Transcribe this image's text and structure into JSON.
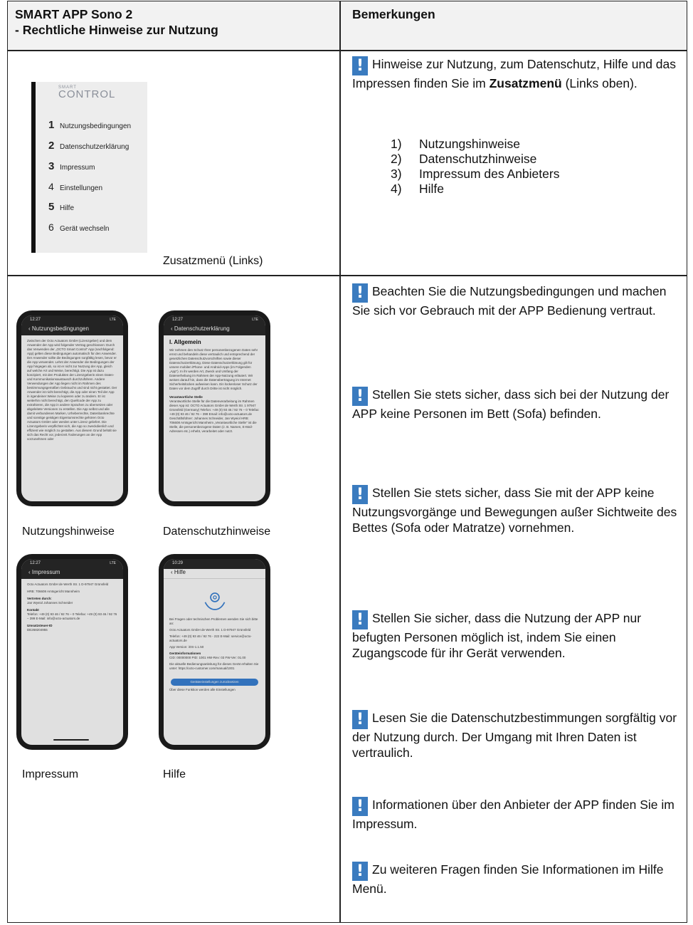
{
  "header": {
    "left_line1": "SMART APP Sono 2",
    "left_line2": "- Rechtliche Hinweise zur Nutzung",
    "right": "Bemerkungen"
  },
  "menu_screenshot": {
    "logo_small": "SMART",
    "logo_big": "CONTROL",
    "items": [
      {
        "num": "1",
        "label": "Nutzungsbedingungen"
      },
      {
        "num": "2",
        "label": "Datenschutzerklärung"
      },
      {
        "num": "3",
        "label": "Impressum"
      },
      {
        "num": "4",
        "label": "Einstellungen"
      },
      {
        "num": "5",
        "label": "Hilfe"
      },
      {
        "num": "6",
        "label": "Gerät wechseln"
      }
    ],
    "caption": "Zusatzmenü (Links)"
  },
  "section1_note": {
    "text_before": "Hinweise zur Nutzung, zum Datenschutz, Hilfe und das Impressen finden Sie im",
    "bold": "Zusatzmenü",
    "text_after": "(Links oben).",
    "list": [
      {
        "n": "1)",
        "t": "Nutzungshinweise"
      },
      {
        "n": "2)",
        "t": "Datenschutzhinweise"
      },
      {
        "n": "3)",
        "t": "Impressum des Anbieters"
      },
      {
        "n": "4)",
        "t": "Hilfe"
      }
    ]
  },
  "phones": {
    "p1": {
      "time": "12:27",
      "status": "LTE",
      "title": "Nutzungsbedingungen",
      "caption": "Nutzungshinweise",
      "text": "Zwischen der Octo Actuators GmbH (Lizenzgeber) und dem Anwender der App wird folgender Vertrag geschlossen: Durch das Verwenden der „OCTO Smart Control\" App (nachfolgend: App) gelten diese Bedingungen automatisch für den Anwender. Der Anwender sollte die Bedingungen sorgfältig lesen, bevor er die App verwendet. Lehnt der Anwender die Bedingungen der App hingegen ab, so ist er nicht zur Nutzung der App, gleich auf welche Art und Weise, berechtigt. Die App ist dazu konzipiert, mit den Produkten der Lizenzgeberin einen Daten- und Kommunikationsaustausch durchzuführen. Andere Verwendungen der App liegen nicht im Rahmen des bestimmungsgemäßen Gebrauchs und sind nicht gestattet. Der Anwender ist nicht berechtigt, die App oder einen Teil der App in irgendeiner Weise zu kopieren oder zu ändern. Er ist weiterhin nicht berechtigt, den Quellcode der App zu extrahieren, die App in andere Sprachen zu übersetzen oder abgeleitete Versionen zu erstellen. Die App selbst und alle damit verbundenen Marken, Urheberrechte, Datenbankrechte und sonstige geistigen Eigentumsrechte gehören Octo Actuators GmbH oder werden unter Lizenz geliefert. Die Lizenzgeberin verpflichtet sich, die App so zweckdienlich und effizient wie möglich zu gestalten. Aus diesem Grund behält sie sich das Recht vor, jederzeit Änderungen an der App vorzunehmen oder"
    },
    "p2": {
      "time": "12:27",
      "status": "LTE",
      "title": "Datenschutzerklärung",
      "caption": "Datenschutzhinweise",
      "heading": "I. Allgemein",
      "text1": "Wir nehmen den Schutz Ihrer personenbezogenen Daten sehr ernst und behandeln diese vertraulich und entsprechend der gesetzlichen Datenschutzvorschriften sowie dieser Datenschutzerklärung. Diese Datenschutzerklärung gilt für unsere mobilen iPhone- und Android-Apps (im Folgenden „App\"). In ihr werden Art, Zweck und Umfang der Datenerhebung im Rahmen der App-Nutzung erläutert. Wir weisen darauf hin, dass die Datenübertragung im Internet Sicherheitslücken aufweisen kann. Ein lückenloser Schutz der Daten vor dem Zugriff durch Dritte ist nicht möglich.",
      "sub": "Verantwortliche Stelle",
      "text2": "Verantwortliche Stelle für die Datenverarbeitung im Rahmen dieser App ist: OCTO Actuators GmbH de Werth Str. 1 97947 Grünsfeld (Germany) Telefon: +49 (0) 93 46 / 92 76 – 0 Telefax: +49 (0) 93 46 / 92 76 – 399 Email: info@octo-actuators.de Geschäftsführer: Johannes Schneider, Jan Wyeiol HRB: 706608 Amtsgericht Mannheim „Verantwortliche Stelle\" ist die Stelle, die personenbezogene Daten (z. B. Namen, E-Mail-Adressen etc.) erhebt, verarbeitet oder nutzt."
    },
    "p3": {
      "time": "12:27",
      "status": "LTE",
      "title": "Impressum",
      "caption": "Impressum",
      "text1": "Octo Actuators GmbH de Werth Str. 1 D-97947 Grünsfeld",
      "text2": "HRB: 706608 Amtsgericht Mannheim",
      "sub1": "Vertreten durch:",
      "text3": "Jan Wyeiol Johannes Schneider",
      "sub2": "Kontakt",
      "text4": "Telefon: +49 (0) 93 46 / 92 76 – 0 Telefax: +49 (0) 93 46 / 92 76 – 399 E-Mail: info@octo-actuators.de",
      "sub3": "Umsatzsteuer-ID",
      "text5": "DE268204955"
    },
    "p4": {
      "time": "10:29",
      "title": "Hilfe",
      "caption": "Hilfe",
      "text1": "Bei Fragen oder technischen Problemen wenden Sie sich bitte an:",
      "text2": "Octo Actuators GmbH de Werth Str. 1 D-97947 Grünsfeld",
      "text3": "Telefon: +49 (0) 93 46 / 92 76 - 222 E-Mail: service@octo-actuators.de",
      "text4": "App Version: iOS-1.1.50",
      "sub": "Geräteinformationen",
      "text5": "CID: 00000000 PID: 1001 HW-Rev: 03 FW-Ver: 01.00",
      "text6": "Die aktuelle Bedienungsanleitung für dieses Gerät erhalten Sie unter: https://octo-customer.com/manual/1001",
      "button": "Geräteeinstellungen zurücksetzen",
      "text7": "Über diese Funktion werden alle Einstellungen"
    }
  },
  "notes": [
    "Beachten Sie die Nutzungsbedingungen und machen Sie sich vor Gebrauch mit der APP Bedienung vertraut.",
    "Stellen Sie stets sicher, dass sich bei der Nutzung der APP keine Personen im Bett (Sofa) befinden.",
    "Stellen Sie stets sicher, dass Sie mit der APP keine Nutzungsvorgänge und Bewegungen außer Sichtweite des Bettes (Sofa oder Matratze) vornehmen.",
    "Stellen Sie sicher, dass die Nutzung der APP nur befugten Personen möglich ist, indem Sie einen Zugangscode für ihr Gerät verwenden.",
    "Lesen Sie die Datenschutzbestimmungen sorgfältig vor der Nutzung durch. Der Umgang mit Ihren Daten ist vertraulich.",
    "Informationen über den Anbieter der APP finden Sie im Impressum.",
    "Zu weiteren Fragen finden Sie Informationen im Hilfe Menü."
  ],
  "colors": {
    "warning_icon": "#3a7bbf",
    "header_bg": "#f2f2f2",
    "button_blue": "#3a82d6"
  }
}
